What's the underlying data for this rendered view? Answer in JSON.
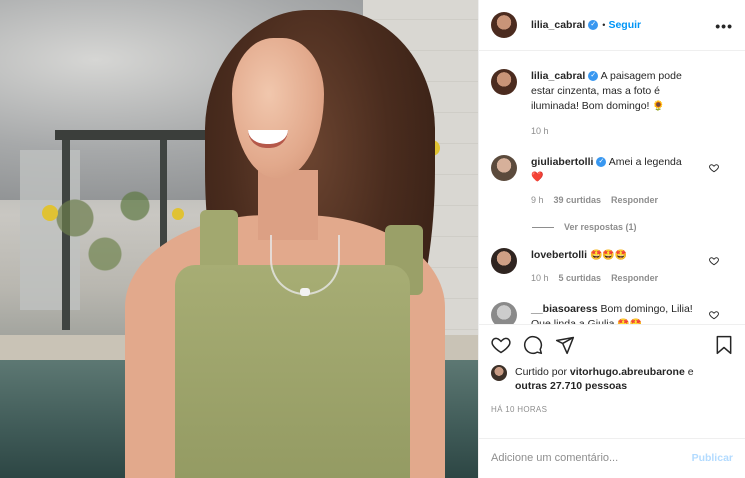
{
  "header": {
    "username": "lilia_cabral",
    "separator": "•",
    "follow_label": "Seguir",
    "more_icon": "•••"
  },
  "caption": {
    "username": "lilia_cabral",
    "text": "A paisagem pode estar cinzenta, mas a foto é iluminada! Bom domingo!",
    "emoji": "🌻",
    "time": "10 h"
  },
  "comments": [
    {
      "username": "giuliabertolli",
      "verified": true,
      "text": "Amei a legenda",
      "emoji": "❤️",
      "time": "9 h",
      "likes": "39 curtidas",
      "reply_label": "Responder",
      "view_replies": "Ver respostas (1)"
    },
    {
      "username": "lovebertolli",
      "verified": false,
      "text": "",
      "emoji": "🤩🤩🤩",
      "time": "10 h",
      "likes": "5 curtidas",
      "reply_label": "Responder"
    },
    {
      "username": "__biasoaress",
      "verified": false,
      "text": "Bom domingo, Lilia! Que linda a Giulia",
      "emoji": "🤩🤩"
    }
  ],
  "likes": {
    "prefix": "Curtido por",
    "user": "vitorhugo.abreubarone",
    "middle": "e",
    "others": "outras 27.710 pessoas"
  },
  "timestamp": "HÁ 10 HORAS",
  "add_comment": {
    "placeholder": "Adicione um comentário...",
    "post_label": "Publicar"
  },
  "colors": {
    "link_blue": "#0095f6",
    "verified_blue": "#3897f0",
    "muted_gray": "#8e8e8e",
    "post_disabled": "#b3dbff"
  }
}
